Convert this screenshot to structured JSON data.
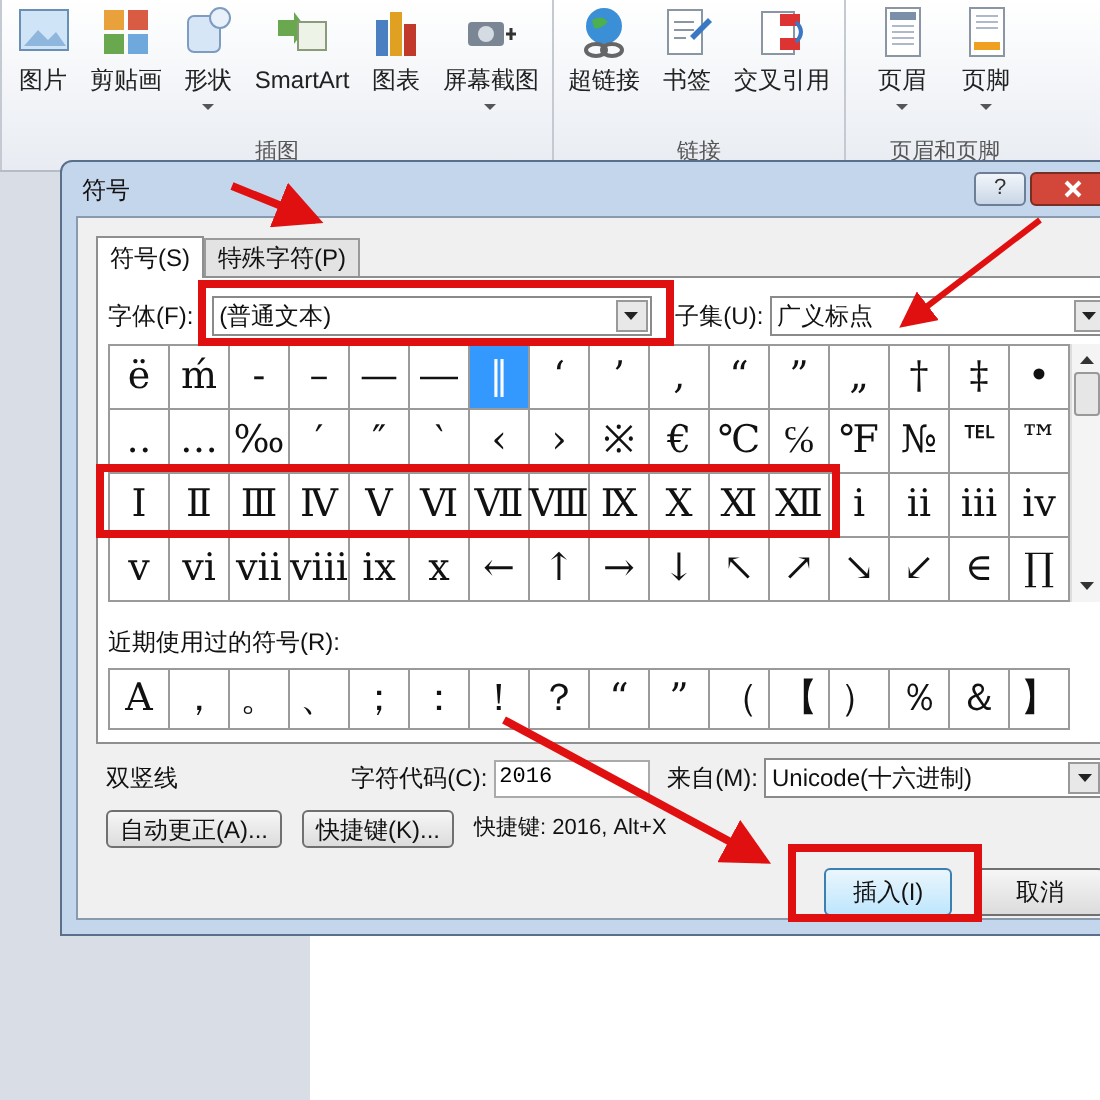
{
  "ribbon": {
    "groups": [
      {
        "label": "插图",
        "buttons": [
          {
            "label": "图片",
            "has_menu": false
          },
          {
            "label": "剪贴画",
            "has_menu": false
          },
          {
            "label": "形状",
            "has_menu": true
          },
          {
            "label": "SmartArt",
            "has_menu": false
          },
          {
            "label": "图表",
            "has_menu": false
          },
          {
            "label": "屏幕截图",
            "has_menu": true
          }
        ]
      },
      {
        "label": "链接",
        "buttons": [
          {
            "label": "超链接",
            "has_menu": false
          },
          {
            "label": "书签",
            "has_menu": false
          },
          {
            "label": "交叉引用",
            "has_menu": false
          }
        ]
      },
      {
        "label": "页眉和页脚",
        "buttons": [
          {
            "label": "页眉",
            "has_menu": true
          },
          {
            "label": "页脚",
            "has_menu": true
          }
        ]
      }
    ]
  },
  "dialog": {
    "title": "符号",
    "help_button": "?",
    "tabs": [
      {
        "label": "符号(S)",
        "selected": true
      },
      {
        "label": "特殊字符(P)",
        "selected": false
      }
    ],
    "font": {
      "label": "字体(F):",
      "value": "(普通文本)"
    },
    "subset": {
      "label": "子集(U):",
      "value": "广义标点"
    },
    "symbols": [
      [
        {
          "c": "ë",
          "selected": false
        },
        {
          "c": "ḿ",
          "selected": false
        },
        {
          "c": "‐",
          "selected": false
        },
        {
          "c": "–",
          "selected": false
        },
        {
          "c": "—",
          "selected": false
        },
        {
          "c": "―",
          "selected": false
        },
        {
          "c": "‖",
          "selected": true
        },
        {
          "c": "‘",
          "selected": false
        },
        {
          "c": "’",
          "selected": false
        },
        {
          "c": "‚",
          "selected": false
        },
        {
          "c": "“",
          "selected": false
        },
        {
          "c": "”",
          "selected": false
        },
        {
          "c": "„",
          "selected": false
        },
        {
          "c": "†",
          "selected": false
        },
        {
          "c": "‡",
          "selected": false
        },
        {
          "c": "•",
          "selected": false
        }
      ],
      [
        {
          "c": "‥",
          "selected": false
        },
        {
          "c": "…",
          "selected": false
        },
        {
          "c": "‰",
          "selected": false
        },
        {
          "c": "′",
          "selected": false
        },
        {
          "c": "″",
          "selected": false
        },
        {
          "c": "‵",
          "selected": false
        },
        {
          "c": "‹",
          "selected": false
        },
        {
          "c": "›",
          "selected": false
        },
        {
          "c": "※",
          "selected": false
        },
        {
          "c": "€",
          "selected": false
        },
        {
          "c": "℃",
          "selected": false
        },
        {
          "c": "℅",
          "selected": false
        },
        {
          "c": "℉",
          "selected": false
        },
        {
          "c": "№",
          "selected": false
        },
        {
          "c": "℡",
          "selected": false
        },
        {
          "c": "™",
          "selected": false
        }
      ],
      [
        {
          "c": "Ⅰ",
          "selected": false
        },
        {
          "c": "Ⅱ",
          "selected": false
        },
        {
          "c": "Ⅲ",
          "selected": false
        },
        {
          "c": "Ⅳ",
          "selected": false
        },
        {
          "c": "Ⅴ",
          "selected": false
        },
        {
          "c": "Ⅵ",
          "selected": false
        },
        {
          "c": "Ⅶ",
          "selected": false
        },
        {
          "c": "Ⅷ",
          "selected": false
        },
        {
          "c": "Ⅸ",
          "selected": false
        },
        {
          "c": "Ⅹ",
          "selected": false
        },
        {
          "c": "Ⅺ",
          "selected": false
        },
        {
          "c": "Ⅻ",
          "selected": false
        },
        {
          "c": "ⅰ",
          "selected": false
        },
        {
          "c": "ⅱ",
          "selected": false
        },
        {
          "c": "ⅲ",
          "selected": false
        },
        {
          "c": "ⅳ",
          "selected": false
        }
      ],
      [
        {
          "c": "ⅴ",
          "selected": false
        },
        {
          "c": "ⅵ",
          "selected": false
        },
        {
          "c": "ⅶ",
          "selected": false
        },
        {
          "c": "ⅷ",
          "selected": false
        },
        {
          "c": "ⅸ",
          "selected": false
        },
        {
          "c": "ⅹ",
          "selected": false
        },
        {
          "c": "←",
          "selected": false
        },
        {
          "c": "↑",
          "selected": false
        },
        {
          "c": "→",
          "selected": false
        },
        {
          "c": "↓",
          "selected": false
        },
        {
          "c": "↖",
          "selected": false
        },
        {
          "c": "↗",
          "selected": false
        },
        {
          "c": "↘",
          "selected": false
        },
        {
          "c": "↙",
          "selected": false
        },
        {
          "c": "∈",
          "selected": false
        },
        {
          "c": "∏",
          "selected": false
        }
      ]
    ],
    "recent_label": "近期使用过的符号(R):",
    "recent": [
      "A",
      "，",
      "。",
      "、",
      "；",
      "：",
      "！",
      "？",
      "“",
      "”",
      "（",
      "【",
      "）",
      "％",
      "＆",
      "】"
    ],
    "char_name": "双竖线",
    "char_code": {
      "label": "字符代码(C):",
      "value": "2016"
    },
    "from": {
      "label": "来自(M):",
      "value": "Unicode(十六进制)"
    },
    "autocorrect_button": "自动更正(A)...",
    "shortcut_button": "快捷键(K)...",
    "shortcut_text": "快捷键: 2016, Alt+X",
    "insert_button": "插入(I)",
    "cancel_button": "取消"
  }
}
